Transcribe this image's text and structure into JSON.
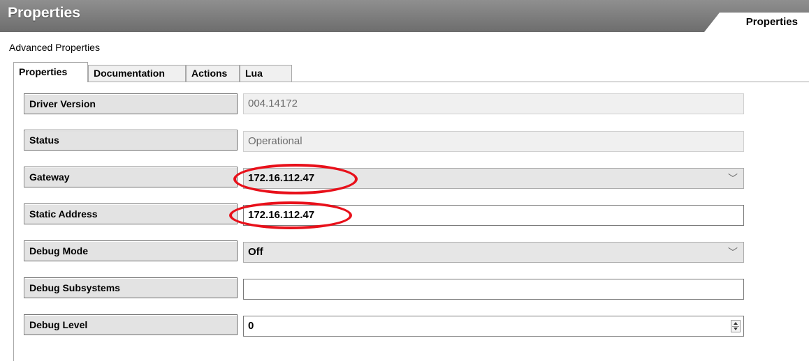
{
  "window": {
    "title": "Properties",
    "top_tab": "Properties"
  },
  "section_title": "Advanced Properties",
  "tabs": [
    {
      "label": "Properties",
      "active": true
    },
    {
      "label": "Documentation",
      "active": false
    },
    {
      "label": "Actions",
      "active": false
    },
    {
      "label": "Lua",
      "active": false
    }
  ],
  "properties": {
    "driver_version": {
      "label": "Driver Version",
      "value": "004.14172"
    },
    "status": {
      "label": "Status",
      "value": "Operational"
    },
    "gateway": {
      "label": "Gateway",
      "value": "172.16.112.47"
    },
    "static_address": {
      "label": "Static Address",
      "value": "172.16.112.47"
    },
    "debug_mode": {
      "label": "Debug Mode",
      "value": "Off"
    },
    "debug_subsystems": {
      "label": "Debug Subsystems",
      "value": ""
    },
    "debug_level": {
      "label": "Debug Level",
      "value": "0"
    }
  },
  "icons": {
    "dropdown": "chevron-down-icon",
    "spinner": "spinner-arrows-icon"
  },
  "colors": {
    "titlebar": "#7d7d7d",
    "highlight_annotation": "#e8101a"
  }
}
